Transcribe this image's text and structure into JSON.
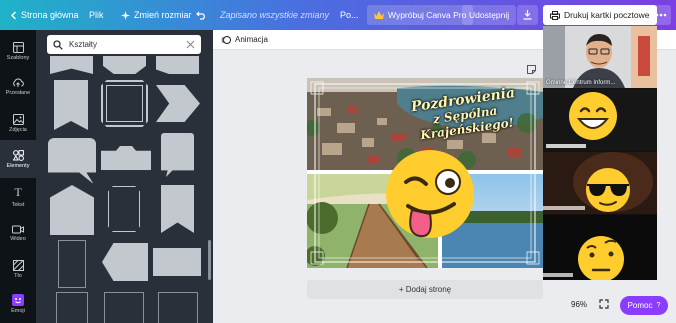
{
  "topbar": {
    "back_label": "Strona główna",
    "file_label": "Plik",
    "resize_label": "Zmień rozmiar",
    "saved_status": "Zapisano wszystkie zmiany",
    "truncated_label": "Po...",
    "try_pro_label": "Wypróbuj Canva Pro",
    "share_label": "Udostępnij",
    "print_label": "Drukuj kartki pocztowe"
  },
  "sidebar": {
    "items": [
      {
        "label": "Szablony",
        "icon": "template-icon"
      },
      {
        "label": "Przesłane",
        "icon": "upload-icon"
      },
      {
        "label": "Zdjęcia",
        "icon": "photo-icon"
      },
      {
        "label": "Elementy",
        "icon": "elements-icon"
      },
      {
        "label": "Tekst",
        "icon": "text-icon"
      },
      {
        "label": "Wideo",
        "icon": "video-icon"
      },
      {
        "label": "Tło",
        "icon": "background-icon"
      },
      {
        "label": "Emoji",
        "icon": "emoji-icon"
      }
    ]
  },
  "panel": {
    "search_value": "Kształty"
  },
  "editor": {
    "animation_label": "Animacja",
    "add_page_label": "+ Dodaj stronę",
    "zoom_value": "96%",
    "help_label": "Pomoc",
    "help_icon_text": "?"
  },
  "postcard": {
    "greeting_line1": "Pozdrowienia",
    "greeting_line2": "z Sępólna Krajeńskiego!"
  },
  "video_call": {
    "participant_label": "Gminne Centrum Inform...",
    "tiles": [
      "webcam",
      "emoji-grin",
      "emoji-sunglasses",
      "emoji-raised-eyebrow"
    ]
  },
  "colors": {
    "accent": "#8b3dff",
    "rail_bg": "#0e1318",
    "panel_bg": "#293039",
    "emoji_yellow": "#ffcd2e"
  }
}
